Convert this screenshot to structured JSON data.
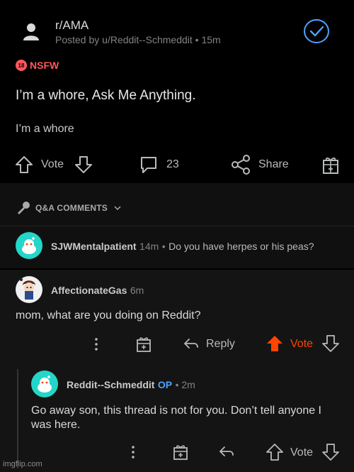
{
  "post": {
    "subreddit": "r/AMA",
    "posted_by": "Posted by u/Reddit--Schmeddit • 15m",
    "nsfw_badge": "18",
    "nsfw_label": "NSFW",
    "title": "I’m a whore, Ask Me Anything.",
    "body": "I’m a whore",
    "vote_label": "Vote",
    "comment_count": "23",
    "share_label": "Share"
  },
  "qa": {
    "label": "Q&A COMMENTS",
    "comment": {
      "user": "SJWMentalpatient",
      "age": "14m",
      "text": "Do you have herpes or his peas?"
    }
  },
  "comments": [
    {
      "user": "AffectionateGas",
      "age": "6m",
      "body": "mom, what are you doing on Reddit?",
      "reply_label": "Reply",
      "vote_label": "Vote"
    },
    {
      "user": "Reddit--Schmeddit",
      "op_badge": "OP",
      "age": "• 2m",
      "body_line1": "Go away son, this thread is not for you. Don’t tell anyone I",
      "body_line2": "was here.",
      "vote_label": "Vote"
    }
  ],
  "watermark": "imgflip.com",
  "colors": {
    "background": "#000000",
    "nsfw": "#ff585b",
    "upvote_active": "#ff4500",
    "op": "#4fa3ff",
    "avatar_teal": "#24d6c8",
    "check_blue": "#4fa3ff"
  }
}
